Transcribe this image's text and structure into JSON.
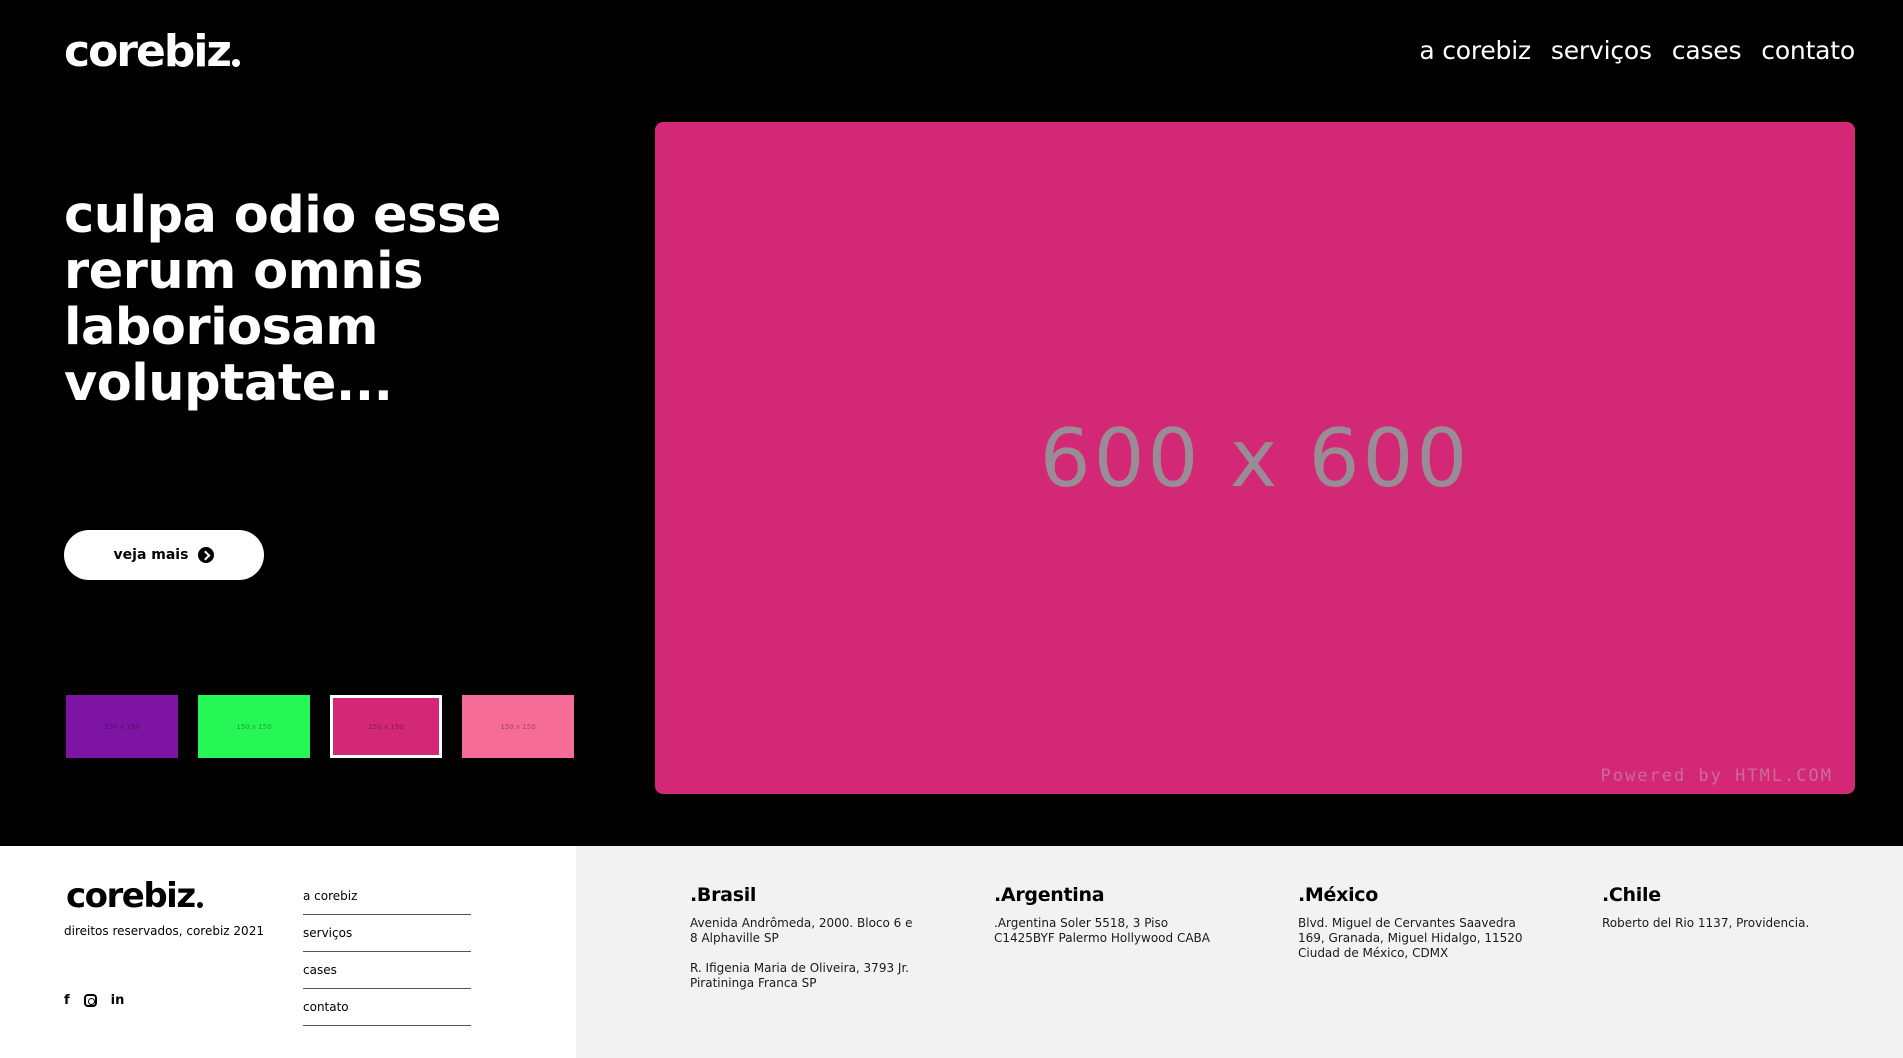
{
  "header": {
    "logo_text": "corebiz",
    "nav": [
      {
        "label": "a corebiz"
      },
      {
        "label": "serviços"
      },
      {
        "label": "cases"
      },
      {
        "label": "contato"
      }
    ]
  },
  "hero": {
    "headline_lines": [
      "culpa odio esse",
      "rerum omnis",
      "laboriosam",
      "voluptate..."
    ],
    "cta_label": "veja mais",
    "cta_icon": "arrow-circle-right-icon",
    "main_image": {
      "label": "600 x 600",
      "watermark": "Powered by HTML.COM",
      "color": "#d32876"
    },
    "thumbnails": [
      {
        "label": "150 x 150",
        "color": "#7e14a4",
        "active": false
      },
      {
        "label": "150 x 150",
        "color": "#26f757",
        "active": false
      },
      {
        "label": "150 x 150",
        "color": "#d32876",
        "active": true
      },
      {
        "label": "150 x 150",
        "color": "#f66c99",
        "active": false
      }
    ]
  },
  "footer": {
    "logo_text": "corebiz",
    "rights": "direitos reservados, corebiz 2021",
    "socials": [
      {
        "icon": "facebook-icon",
        "glyph": "f"
      },
      {
        "icon": "instagram-icon",
        "glyph": ""
      },
      {
        "icon": "linkedin-icon",
        "glyph": "in"
      }
    ],
    "links": [
      {
        "label": "a corebiz"
      },
      {
        "label": "serviços"
      },
      {
        "label": "cases"
      },
      {
        "label": "contato"
      }
    ],
    "offices": [
      {
        "country": ".Brasil",
        "addresses": [
          "Avenida Andrômeda, 2000. Bloco 6 e 8 Alphaville SP",
          "R. Ifigenia Maria de Oliveira, 3793 Jr. Piratininga Franca SP"
        ]
      },
      {
        "country": ".Argentina",
        "addresses": [
          ".Argentina Soler 5518, 3 Piso C1425BYF Palermo Hollywood CABA"
        ]
      },
      {
        "country": ".México",
        "addresses": [
          "Blvd. Miguel de Cervantes Saavedra 169, Granada, Miguel Hidalgo, 11520 Ciudad de México, CDMX"
        ]
      },
      {
        "country": ".Chile",
        "addresses": [
          "Roberto del Rio 1137, Providencia."
        ]
      }
    ]
  },
  "colors": {
    "hero_bg": "#000000",
    "footer_right_bg": "#f2f2f2"
  }
}
